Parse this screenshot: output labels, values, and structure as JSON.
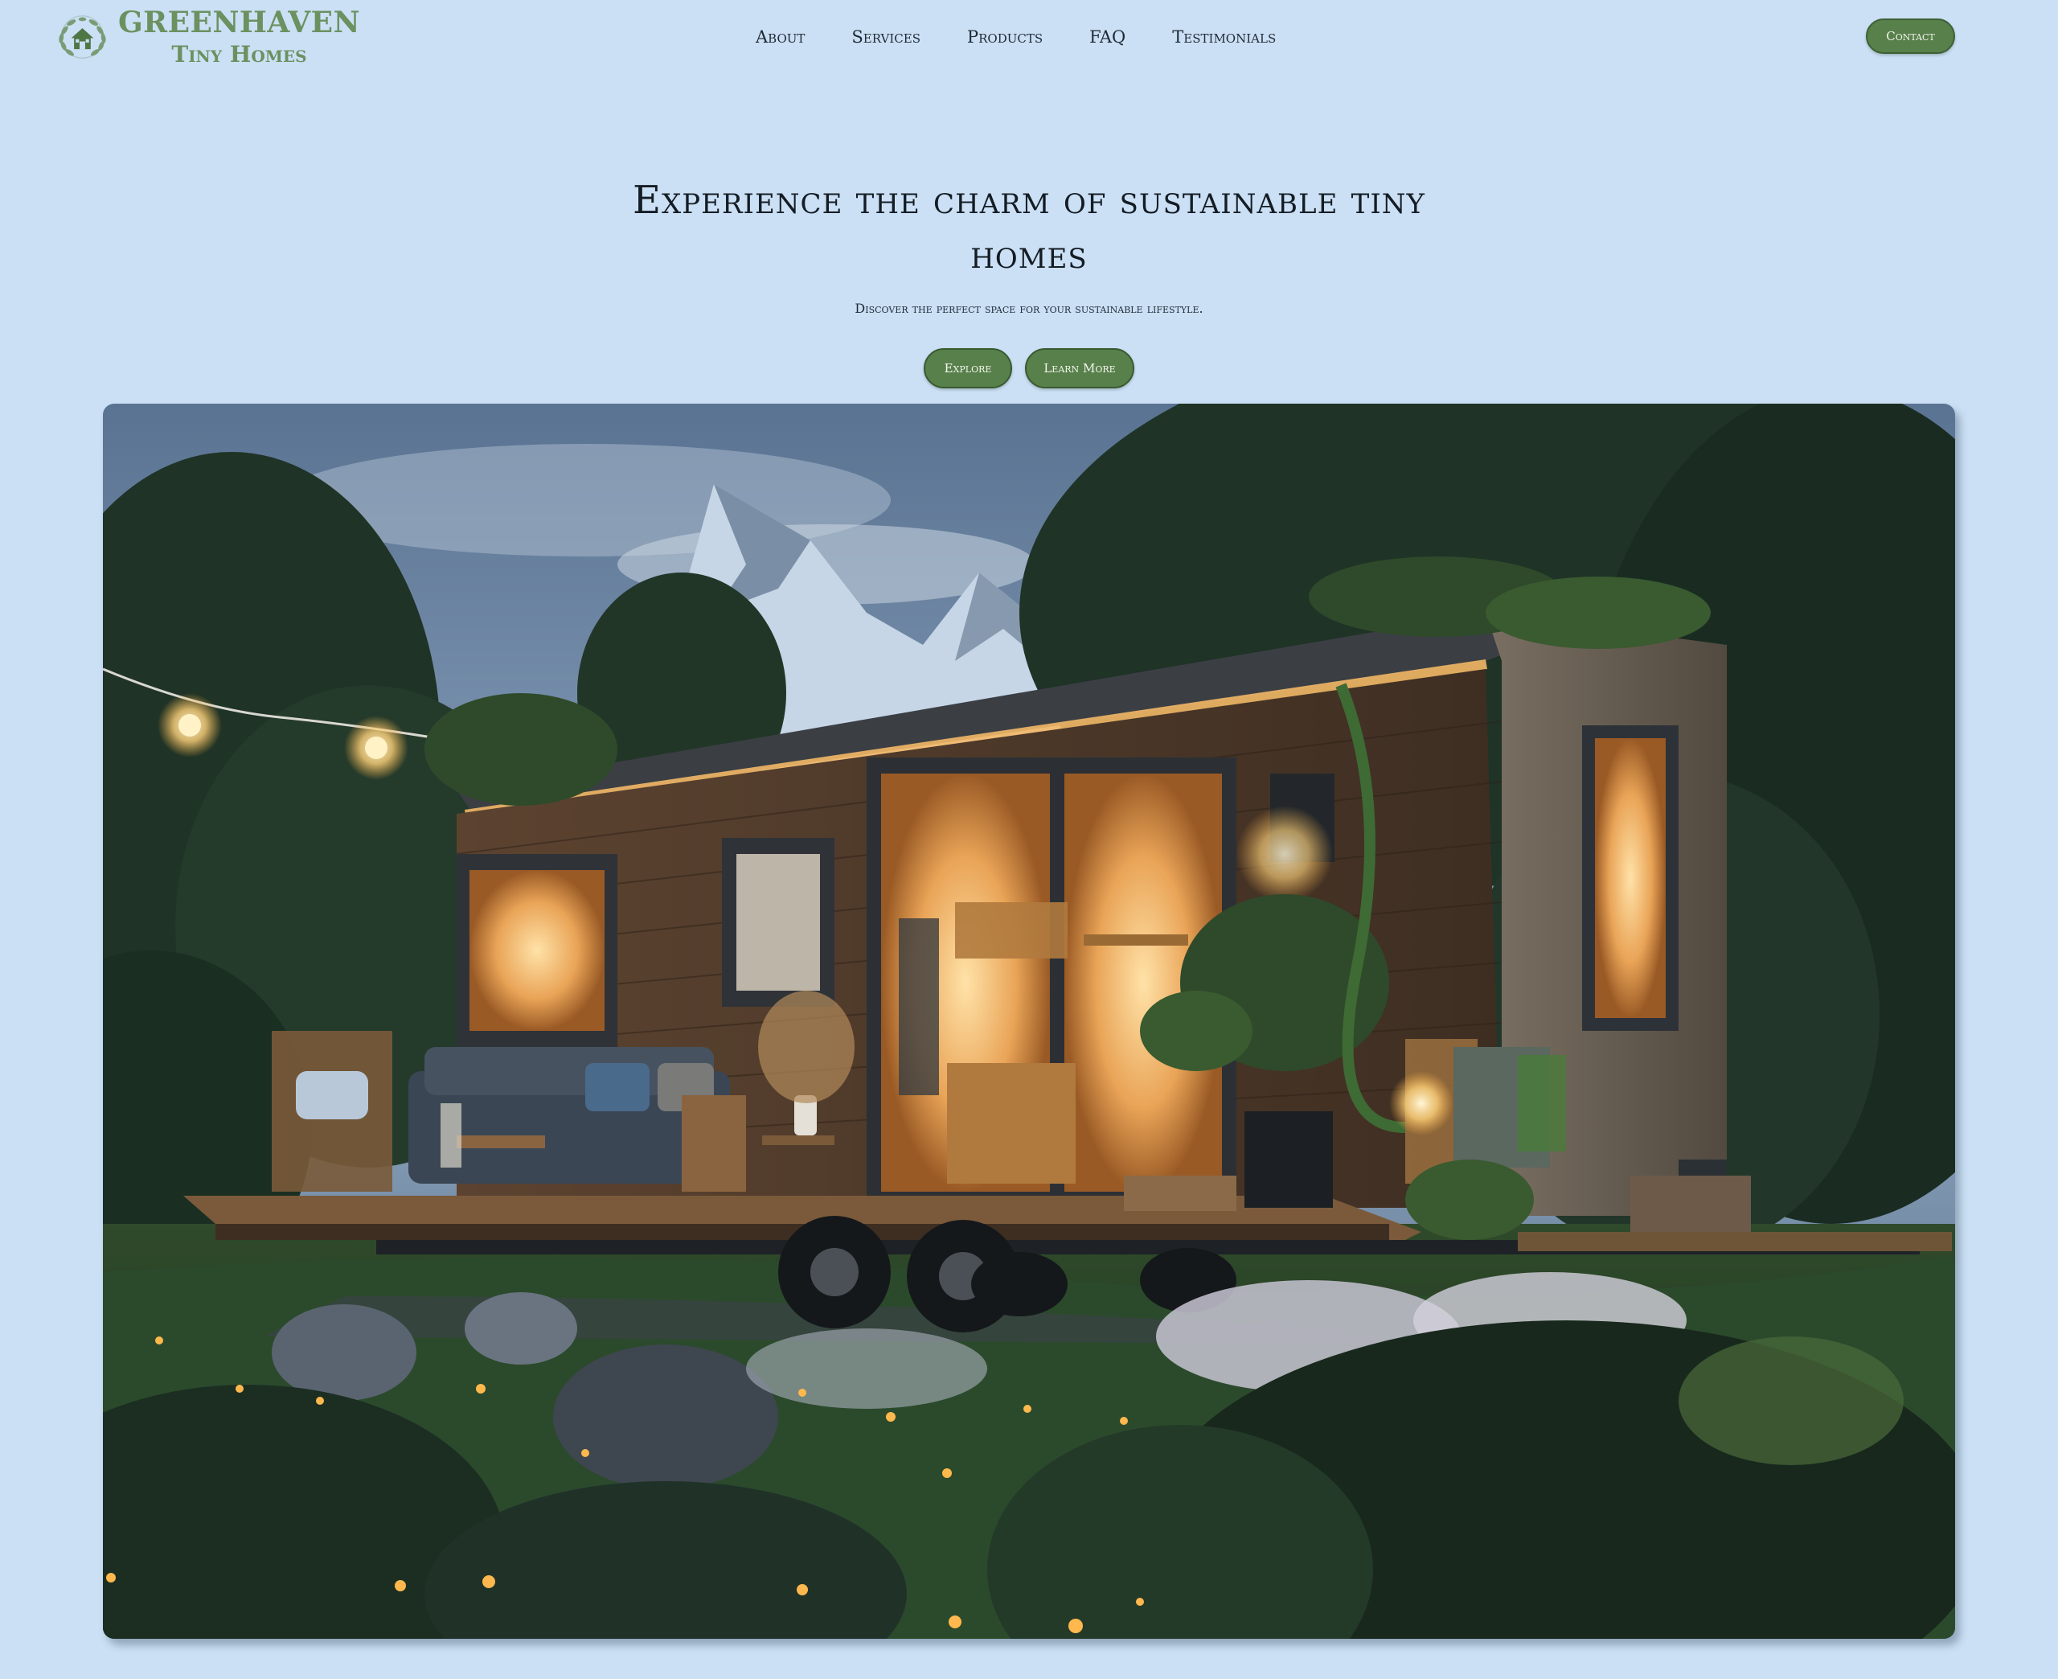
{
  "brand": {
    "name_line1": "GREENHAVEN",
    "name_line2": "Tiny Homes",
    "emblem_icon": "house-in-leaf-wreath-icon",
    "color": "#6b9160"
  },
  "nav": {
    "links": [
      {
        "label": "About"
      },
      {
        "label": "Services"
      },
      {
        "label": "Products"
      },
      {
        "label": "FAQ"
      },
      {
        "label": "Testimonials"
      }
    ],
    "contact_label": "Contact"
  },
  "hero": {
    "title": "Experience the charm of sustainable tiny homes",
    "subtitle": "Discover the perfect space for your sustainable lifestyle.",
    "buttons": {
      "explore_label": "Explore",
      "learn_more_label": "Learn More"
    }
  },
  "theme": {
    "background": "#cbe0f5",
    "accent": "#58804b",
    "button_text": "#f3f6ee",
    "text": "#141c24"
  }
}
